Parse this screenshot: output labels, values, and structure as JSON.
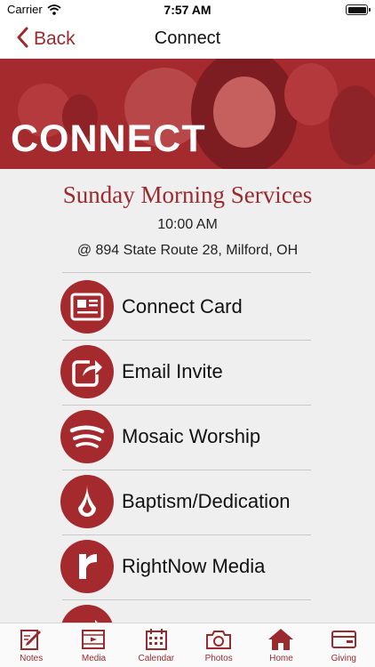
{
  "status_bar": {
    "carrier": "Carrier",
    "time": "7:57 AM"
  },
  "nav": {
    "back_label": "Back",
    "title": "Connect"
  },
  "hero": {
    "title": "CONNECT"
  },
  "service": {
    "title": "Sunday Morning Services",
    "time": "10:00 AM",
    "address": "@ 894 State Route 28, Milford, OH"
  },
  "items": [
    {
      "label": "Connect Card",
      "icon": "card-icon"
    },
    {
      "label": "Email Invite",
      "icon": "share-icon"
    },
    {
      "label": "Mosaic Worship",
      "icon": "spotify-icon"
    },
    {
      "label": "Baptism/Dedication",
      "icon": "water-drop-icon"
    },
    {
      "label": "RightNow Media",
      "icon": "rightnow-icon"
    }
  ],
  "tabs": [
    {
      "label": "Notes",
      "icon": "notes-icon"
    },
    {
      "label": "Media",
      "icon": "media-icon"
    },
    {
      "label": "Calendar",
      "icon": "calendar-icon"
    },
    {
      "label": "Photos",
      "icon": "camera-icon"
    },
    {
      "label": "Home",
      "icon": "home-icon"
    },
    {
      "label": "Giving",
      "icon": "wallet-icon"
    }
  ],
  "colors": {
    "accent": "#a52a2e",
    "background": "#efeff0"
  }
}
